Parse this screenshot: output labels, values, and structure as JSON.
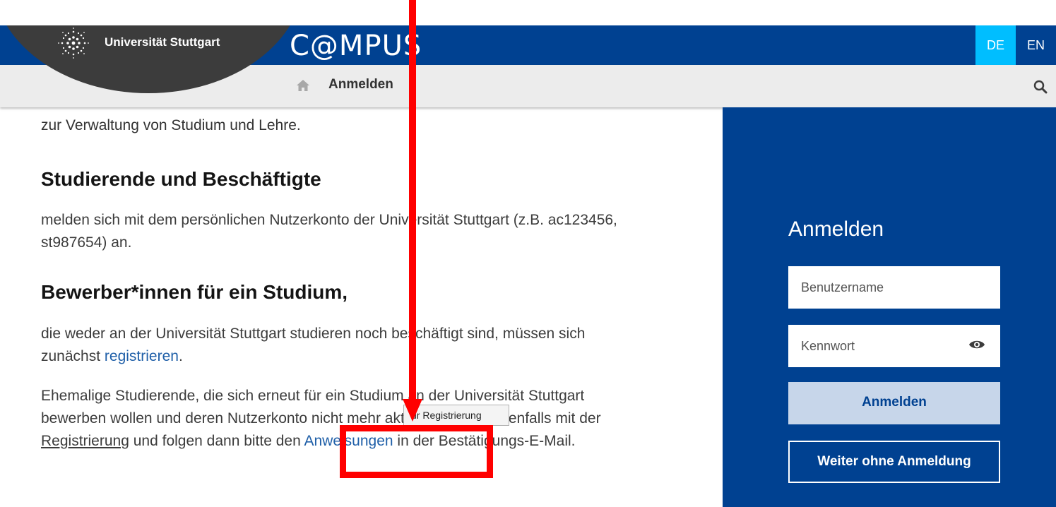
{
  "header": {
    "university_name": "Universität Stuttgart",
    "app_title": "C@MPUS",
    "languages": [
      {
        "code": "DE",
        "active": true
      },
      {
        "code": "EN",
        "active": false
      }
    ],
    "brand_color": "#004191",
    "active_lang_color": "#00beff"
  },
  "nav": {
    "home_icon": "home-icon",
    "current_page": "Anmelden",
    "search_icon": "search-icon"
  },
  "main": {
    "intro_text": "zur Verwaltung von Studium und Lehre.",
    "section_students": {
      "heading": "Studierende und Beschäftigte",
      "text": "melden sich mit dem persönlichen Nutzerkonto der Universität Stuttgart (z.B. ac123456, st987654) an."
    },
    "section_applicants": {
      "heading": "Bewerber*innen für ein Studium,",
      "text_before": "die weder an der Universität Stuttgart studieren noch beschäftigt sind, müssen sich zunächst ",
      "link_register": "registrieren",
      "text_after": "."
    },
    "section_former": {
      "text_before": "Ehemalige Studierende, die sich erneut für ein Studium an der Universität Stuttgart bewerben wollen und deren Nutzerkonto nicht mehr aktiv ist, starten ebenfalls mit der ",
      "link_registration": "Registrierung",
      "text_middle": " und folgen dann bitte den ",
      "link_instructions": "Anweisungen",
      "text_after": " in der Bestätigungs-E-Mail."
    },
    "tooltip": "ur Registrierung"
  },
  "login": {
    "title": "Anmelden",
    "username_placeholder": "Benutzername",
    "password_placeholder": "Kennwort",
    "show_password_icon": "eye-icon",
    "submit_label": "Anmelden",
    "guest_label": "Weiter ohne Anmeldung"
  }
}
